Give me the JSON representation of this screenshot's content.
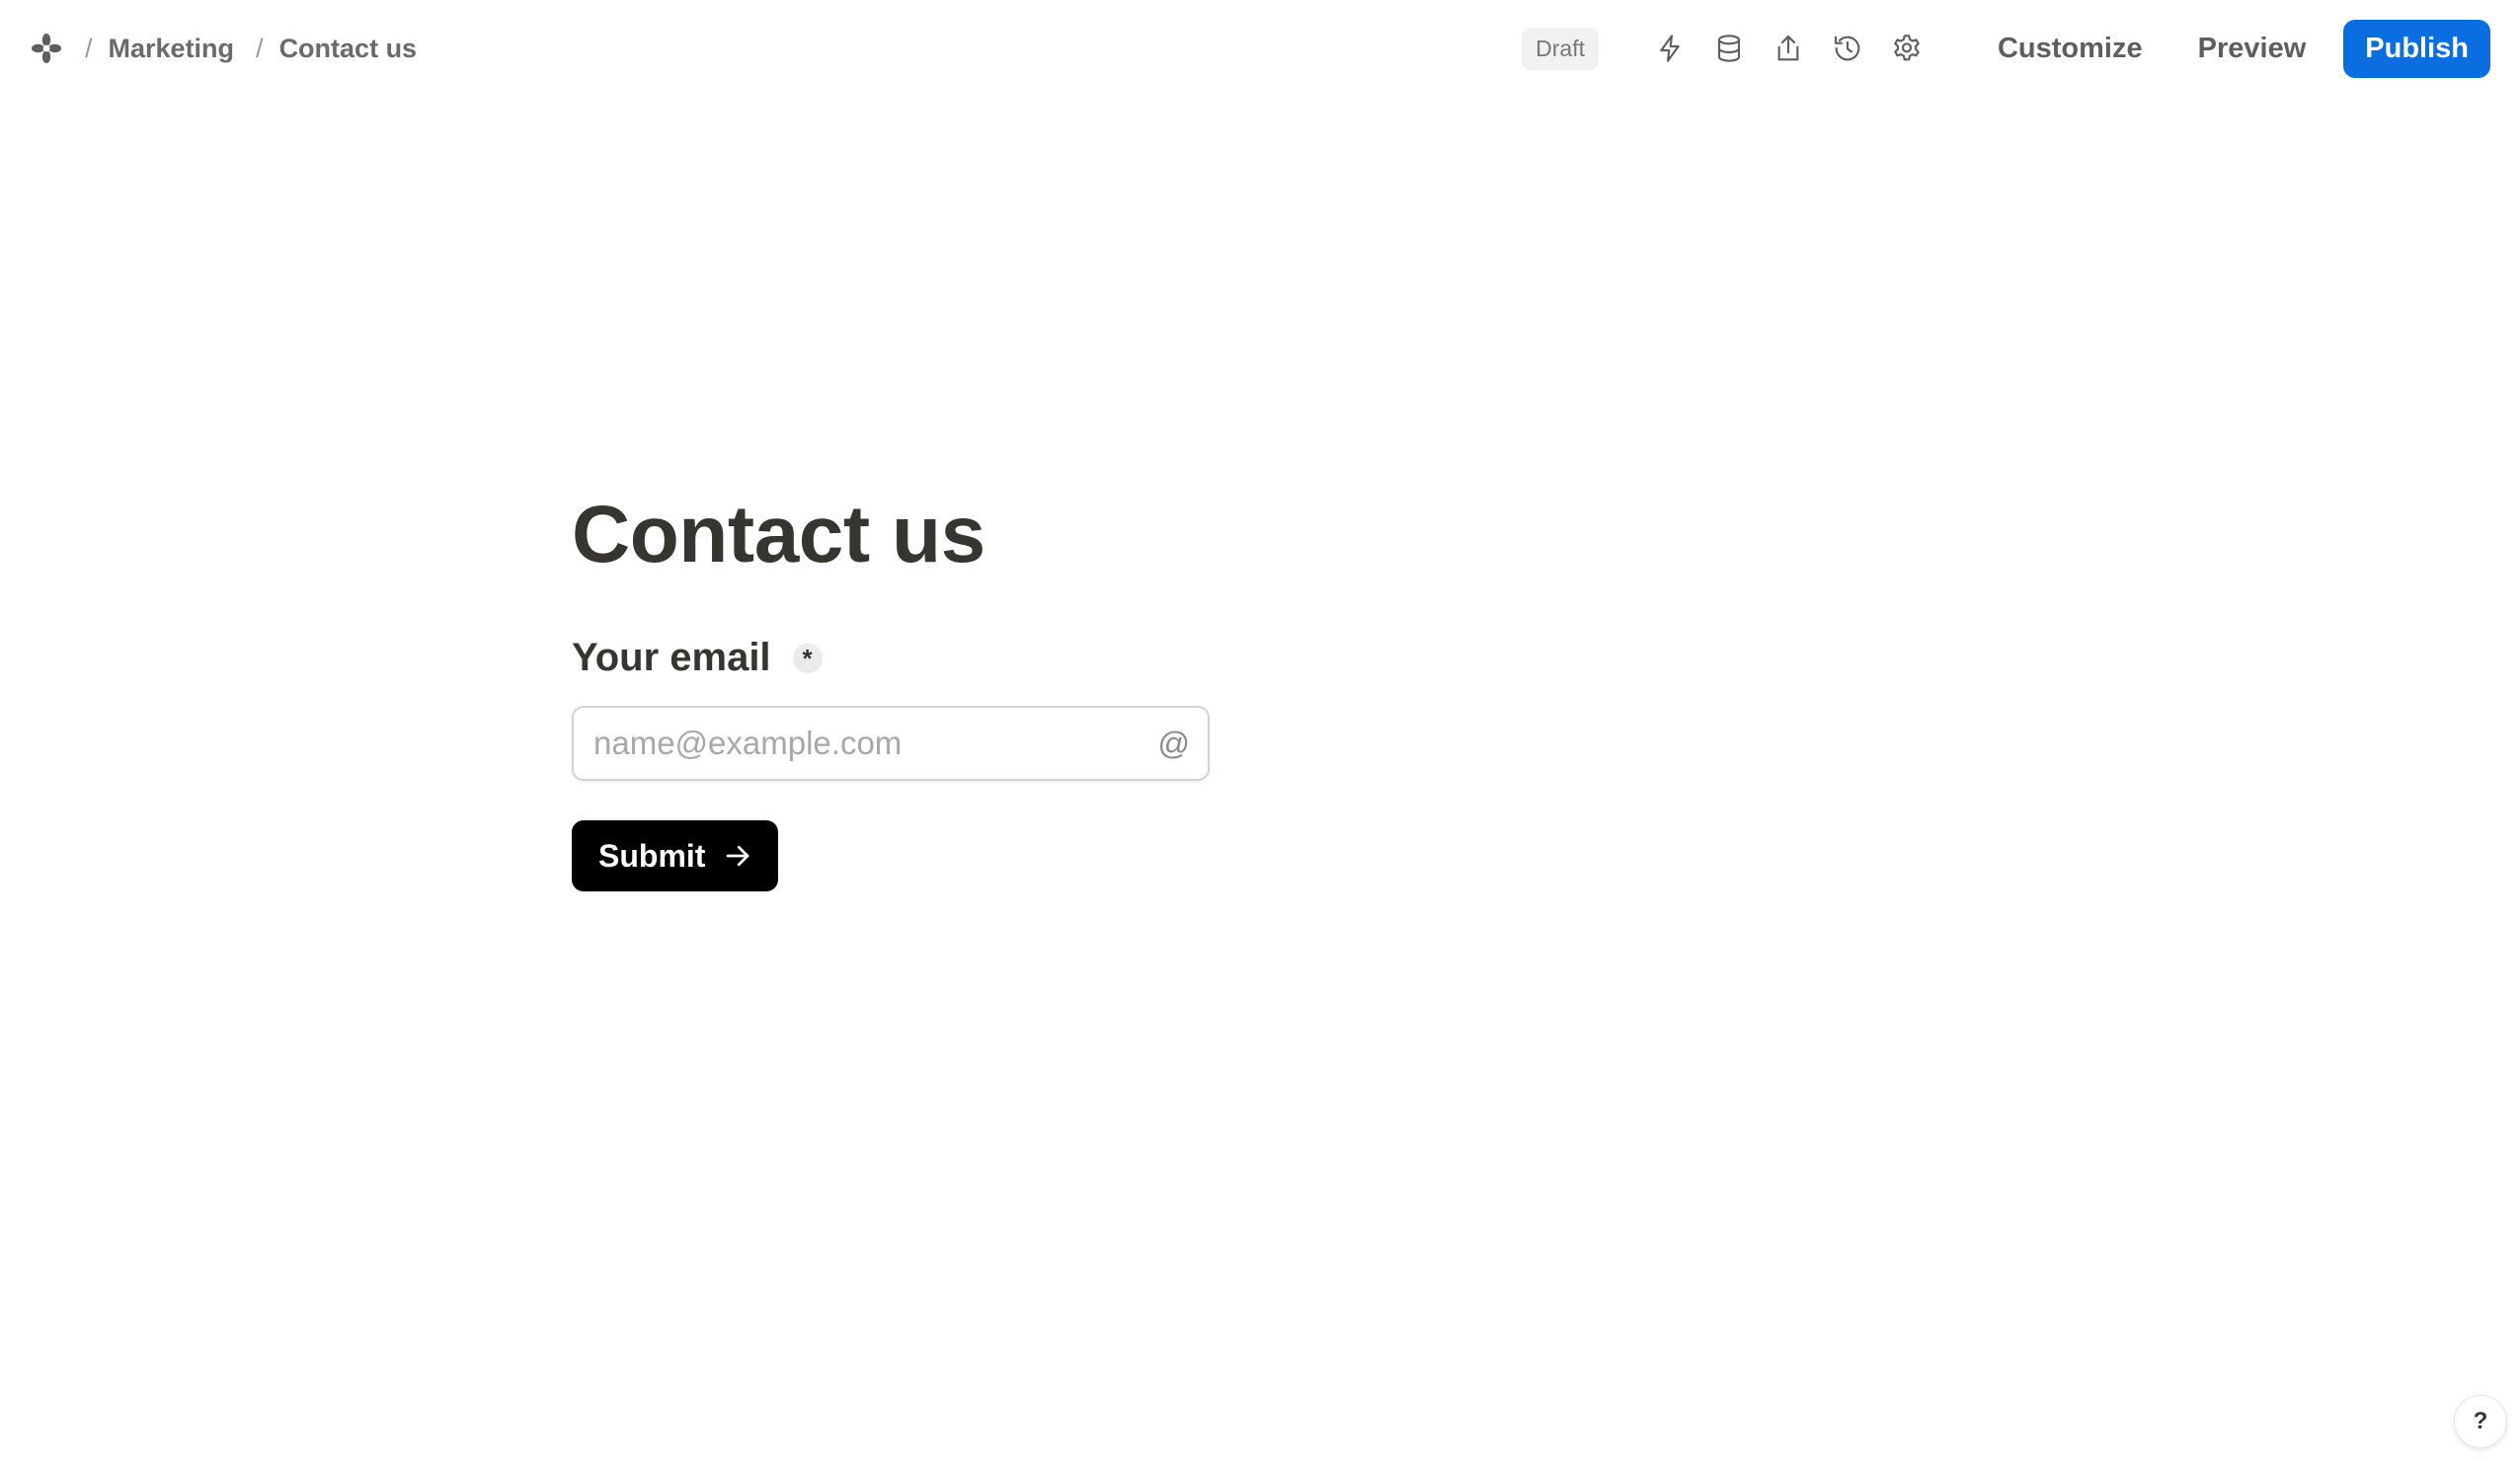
{
  "header": {
    "breadcrumb": [
      "Marketing",
      "Contact us"
    ],
    "separator": "/",
    "status_badge": "Draft",
    "icons": [
      "lightning-icon",
      "database-icon",
      "share-icon",
      "history-icon",
      "settings-icon"
    ],
    "customize_label": "Customize",
    "preview_label": "Preview",
    "publish_label": "Publish"
  },
  "form": {
    "title": "Contact us",
    "field_label": "Your email",
    "required_marker": "*",
    "email_placeholder": "name@example.com",
    "email_value": "",
    "at_symbol": "@",
    "submit_label": "Submit"
  },
  "help": {
    "label": "?"
  },
  "colors": {
    "accent": "#0b6ee0",
    "submit_bg": "#000000",
    "text": "#37352f"
  }
}
